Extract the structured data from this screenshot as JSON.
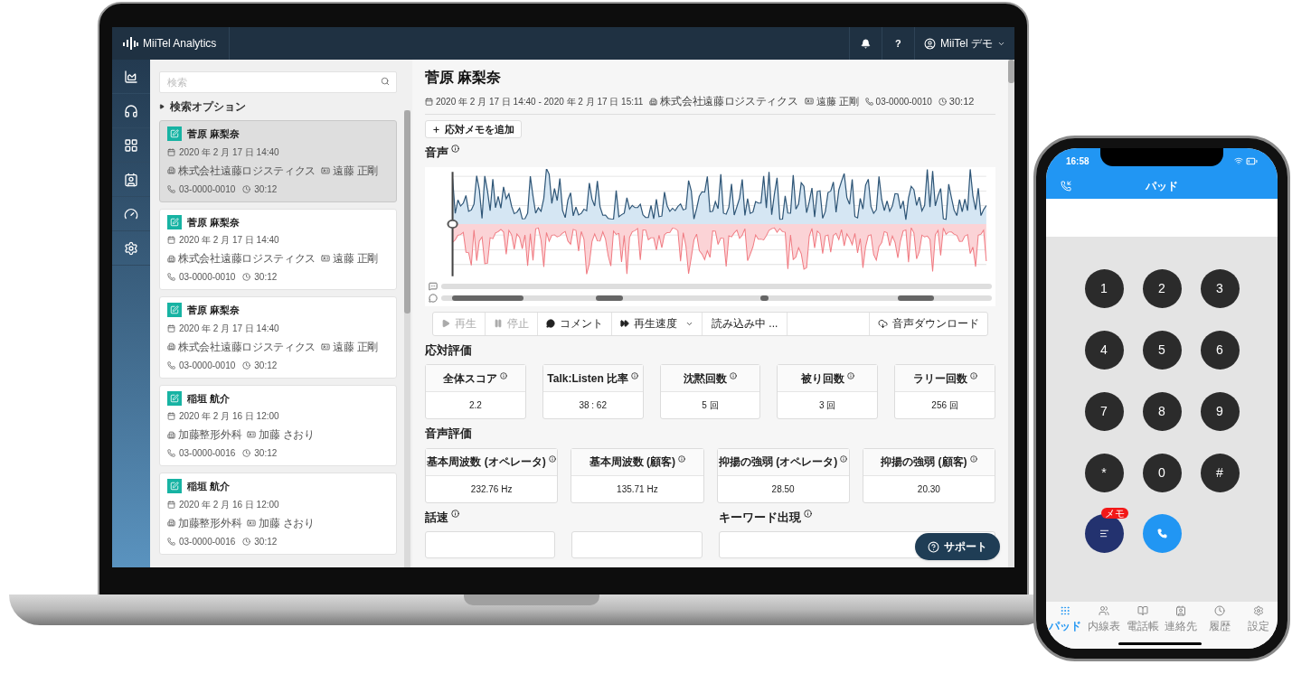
{
  "app": {
    "logo": "MiiTel Analytics",
    "help": "?",
    "user": "MiiTel デモ"
  },
  "search": {
    "placeholder": "検索",
    "options": "検索オプション"
  },
  "calls": [
    {
      "name": "菅原 麻梨奈",
      "date": "2020 年 2 月 17 日 14:40",
      "company": "株式会社遠藤ロジスティクス",
      "person": "遠藤 正剛",
      "phone": "03-0000-0010",
      "duration": "30:12",
      "selected": true
    },
    {
      "name": "菅原 麻梨奈",
      "date": "2020 年 2 月 17 日 14:40",
      "company": "株式会社遠藤ロジスティクス",
      "person": "遠藤 正剛",
      "phone": "03-0000-0010",
      "duration": "30:12",
      "selected": false
    },
    {
      "name": "菅原 麻梨奈",
      "date": "2020 年 2 月 17 日 14:40",
      "company": "株式会社遠藤ロジスティクス",
      "person": "遠藤 正剛",
      "phone": "03-0000-0010",
      "duration": "30:12",
      "selected": false
    },
    {
      "name": "稲垣 航介",
      "date": "2020 年 2 月 16 日 12:00",
      "company": "加藤整形外科",
      "person": "加藤 さおり",
      "phone": "03-0000-0016",
      "duration": "30:12",
      "selected": false
    },
    {
      "name": "稲垣 航介",
      "date": "2020 年 2 月 16 日 12:00",
      "company": "加藤整形外科",
      "person": "加藤 さおり",
      "phone": "03-0000-0016",
      "duration": "30:12",
      "selected": false
    }
  ],
  "detail": {
    "title": "菅原 麻梨奈",
    "period": "2020 年 2 月 17 日 14:40 - 2020 年 2 月 17 日 15:11",
    "company": "株式会社遠藤ロジスティクス",
    "person": "遠藤 正剛",
    "phone": "03-0000-0010",
    "duration": "30:12",
    "add_memo": "応対メモを追加",
    "audio_heading": "音声"
  },
  "player": [
    {
      "kind": "play",
      "label": "再生",
      "disabled": true
    },
    {
      "kind": "pause",
      "label": "停止",
      "disabled": true
    },
    {
      "kind": "comment",
      "label": "コメント",
      "disabled": false
    },
    {
      "kind": "speed",
      "label": "再生速度",
      "disabled": false
    },
    {
      "kind": "status",
      "label": "読み込み中 ...",
      "disabled": false
    },
    {
      "kind": "download",
      "label": "音声ダウンロード",
      "disabled": false
    }
  ],
  "response_eval": {
    "heading": "応対評価",
    "metrics": [
      {
        "label": "全体スコア",
        "value": "2.2"
      },
      {
        "label": "Talk:Listen 比率",
        "value": "38 : 62"
      },
      {
        "label": "沈黙回数",
        "value": "5 回"
      },
      {
        "label": "被り回数",
        "value": "3 回"
      },
      {
        "label": "ラリー回数",
        "value": "256 回"
      }
    ]
  },
  "voice_eval": {
    "heading": "音声評価",
    "metrics": [
      {
        "label": "基本周波数 (オペレータ)",
        "value": "232.76 Hz"
      },
      {
        "label": "基本周波数 (顧客)",
        "value": "135.71 Hz"
      },
      {
        "label": "抑揚の強弱 (オペレータ)",
        "value": "28.50"
      },
      {
        "label": "抑揚の強弱 (顧客)",
        "value": "20.30"
      }
    ]
  },
  "speech_speed": {
    "heading": "話速"
  },
  "keywords": {
    "heading": "キーワード出現"
  },
  "support": "サポート",
  "phone": {
    "time": "16:58",
    "title": "パッド",
    "keys": [
      "1",
      "2",
      "3",
      "4",
      "5",
      "6",
      "7",
      "8",
      "9",
      "*",
      "0",
      "#"
    ],
    "memo_badge": "メモ",
    "tabs": [
      {
        "label": "パッド",
        "selected": true
      },
      {
        "label": "内線表",
        "selected": false
      },
      {
        "label": "電話帳",
        "selected": false
      },
      {
        "label": "連絡先",
        "selected": false
      },
      {
        "label": "履歴",
        "selected": false
      },
      {
        "label": "設定",
        "selected": false
      }
    ]
  }
}
